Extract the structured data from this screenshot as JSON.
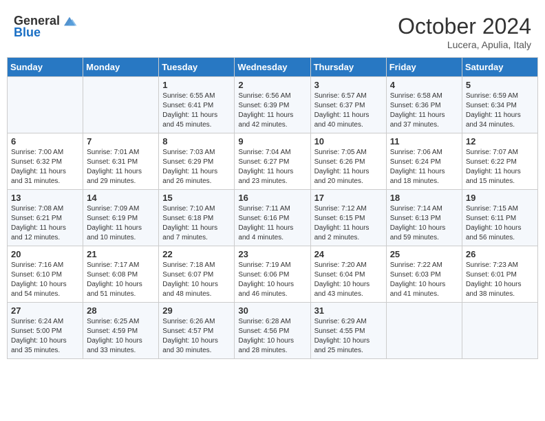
{
  "header": {
    "logo_general": "General",
    "logo_blue": "Blue",
    "month": "October 2024",
    "location": "Lucera, Apulia, Italy"
  },
  "weekdays": [
    "Sunday",
    "Monday",
    "Tuesday",
    "Wednesday",
    "Thursday",
    "Friday",
    "Saturday"
  ],
  "weeks": [
    [
      {
        "day": "",
        "info": ""
      },
      {
        "day": "",
        "info": ""
      },
      {
        "day": "1",
        "info": "Sunrise: 6:55 AM\nSunset: 6:41 PM\nDaylight: 11 hours and 45 minutes."
      },
      {
        "day": "2",
        "info": "Sunrise: 6:56 AM\nSunset: 6:39 PM\nDaylight: 11 hours and 42 minutes."
      },
      {
        "day": "3",
        "info": "Sunrise: 6:57 AM\nSunset: 6:37 PM\nDaylight: 11 hours and 40 minutes."
      },
      {
        "day": "4",
        "info": "Sunrise: 6:58 AM\nSunset: 6:36 PM\nDaylight: 11 hours and 37 minutes."
      },
      {
        "day": "5",
        "info": "Sunrise: 6:59 AM\nSunset: 6:34 PM\nDaylight: 11 hours and 34 minutes."
      }
    ],
    [
      {
        "day": "6",
        "info": "Sunrise: 7:00 AM\nSunset: 6:32 PM\nDaylight: 11 hours and 31 minutes."
      },
      {
        "day": "7",
        "info": "Sunrise: 7:01 AM\nSunset: 6:31 PM\nDaylight: 11 hours and 29 minutes."
      },
      {
        "day": "8",
        "info": "Sunrise: 7:03 AM\nSunset: 6:29 PM\nDaylight: 11 hours and 26 minutes."
      },
      {
        "day": "9",
        "info": "Sunrise: 7:04 AM\nSunset: 6:27 PM\nDaylight: 11 hours and 23 minutes."
      },
      {
        "day": "10",
        "info": "Sunrise: 7:05 AM\nSunset: 6:26 PM\nDaylight: 11 hours and 20 minutes."
      },
      {
        "day": "11",
        "info": "Sunrise: 7:06 AM\nSunset: 6:24 PM\nDaylight: 11 hours and 18 minutes."
      },
      {
        "day": "12",
        "info": "Sunrise: 7:07 AM\nSunset: 6:22 PM\nDaylight: 11 hours and 15 minutes."
      }
    ],
    [
      {
        "day": "13",
        "info": "Sunrise: 7:08 AM\nSunset: 6:21 PM\nDaylight: 11 hours and 12 minutes."
      },
      {
        "day": "14",
        "info": "Sunrise: 7:09 AM\nSunset: 6:19 PM\nDaylight: 11 hours and 10 minutes."
      },
      {
        "day": "15",
        "info": "Sunrise: 7:10 AM\nSunset: 6:18 PM\nDaylight: 11 hours and 7 minutes."
      },
      {
        "day": "16",
        "info": "Sunrise: 7:11 AM\nSunset: 6:16 PM\nDaylight: 11 hours and 4 minutes."
      },
      {
        "day": "17",
        "info": "Sunrise: 7:12 AM\nSunset: 6:15 PM\nDaylight: 11 hours and 2 minutes."
      },
      {
        "day": "18",
        "info": "Sunrise: 7:14 AM\nSunset: 6:13 PM\nDaylight: 10 hours and 59 minutes."
      },
      {
        "day": "19",
        "info": "Sunrise: 7:15 AM\nSunset: 6:11 PM\nDaylight: 10 hours and 56 minutes."
      }
    ],
    [
      {
        "day": "20",
        "info": "Sunrise: 7:16 AM\nSunset: 6:10 PM\nDaylight: 10 hours and 54 minutes."
      },
      {
        "day": "21",
        "info": "Sunrise: 7:17 AM\nSunset: 6:08 PM\nDaylight: 10 hours and 51 minutes."
      },
      {
        "day": "22",
        "info": "Sunrise: 7:18 AM\nSunset: 6:07 PM\nDaylight: 10 hours and 48 minutes."
      },
      {
        "day": "23",
        "info": "Sunrise: 7:19 AM\nSunset: 6:06 PM\nDaylight: 10 hours and 46 minutes."
      },
      {
        "day": "24",
        "info": "Sunrise: 7:20 AM\nSunset: 6:04 PM\nDaylight: 10 hours and 43 minutes."
      },
      {
        "day": "25",
        "info": "Sunrise: 7:22 AM\nSunset: 6:03 PM\nDaylight: 10 hours and 41 minutes."
      },
      {
        "day": "26",
        "info": "Sunrise: 7:23 AM\nSunset: 6:01 PM\nDaylight: 10 hours and 38 minutes."
      }
    ],
    [
      {
        "day": "27",
        "info": "Sunrise: 6:24 AM\nSunset: 5:00 PM\nDaylight: 10 hours and 35 minutes."
      },
      {
        "day": "28",
        "info": "Sunrise: 6:25 AM\nSunset: 4:59 PM\nDaylight: 10 hours and 33 minutes."
      },
      {
        "day": "29",
        "info": "Sunrise: 6:26 AM\nSunset: 4:57 PM\nDaylight: 10 hours and 30 minutes."
      },
      {
        "day": "30",
        "info": "Sunrise: 6:28 AM\nSunset: 4:56 PM\nDaylight: 10 hours and 28 minutes."
      },
      {
        "day": "31",
        "info": "Sunrise: 6:29 AM\nSunset: 4:55 PM\nDaylight: 10 hours and 25 minutes."
      },
      {
        "day": "",
        "info": ""
      },
      {
        "day": "",
        "info": ""
      }
    ]
  ]
}
